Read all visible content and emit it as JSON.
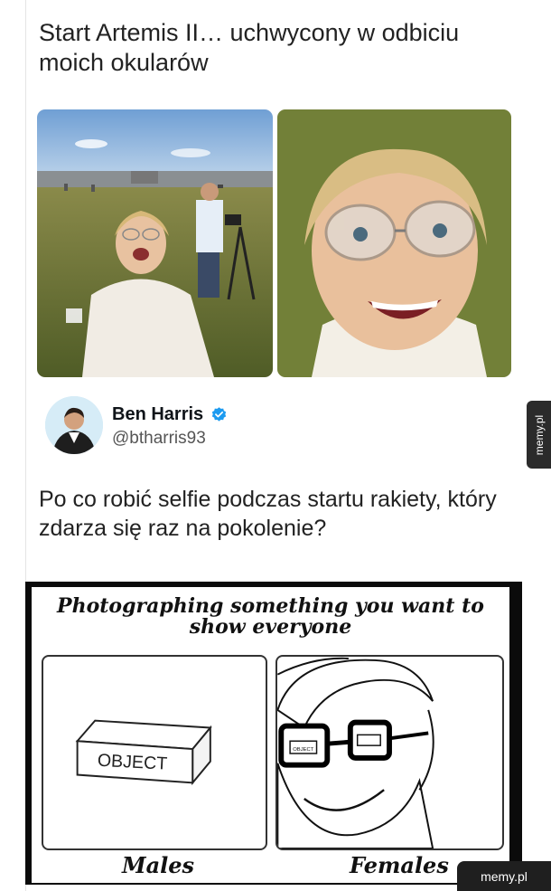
{
  "post": {
    "title": "Start Artemis II… uchwycony w odbiciu moich okularów"
  },
  "tweet": {
    "author_name": "Ben Harris",
    "author_handle": "@btharris93",
    "verified_color": "#1d9bf0"
  },
  "question": "Po co robić selfie podczas startu rakiety, który zdarza się raz na pokolenie?",
  "comic": {
    "title": "Photographing something you want to show everyone",
    "object_label": "OBJECT",
    "reflection_label": "OBJECT",
    "label_left": "Males",
    "label_right": "Females"
  },
  "side_tab": {
    "label": "memy.pl"
  },
  "watermark": {
    "label": "memy.pl"
  }
}
